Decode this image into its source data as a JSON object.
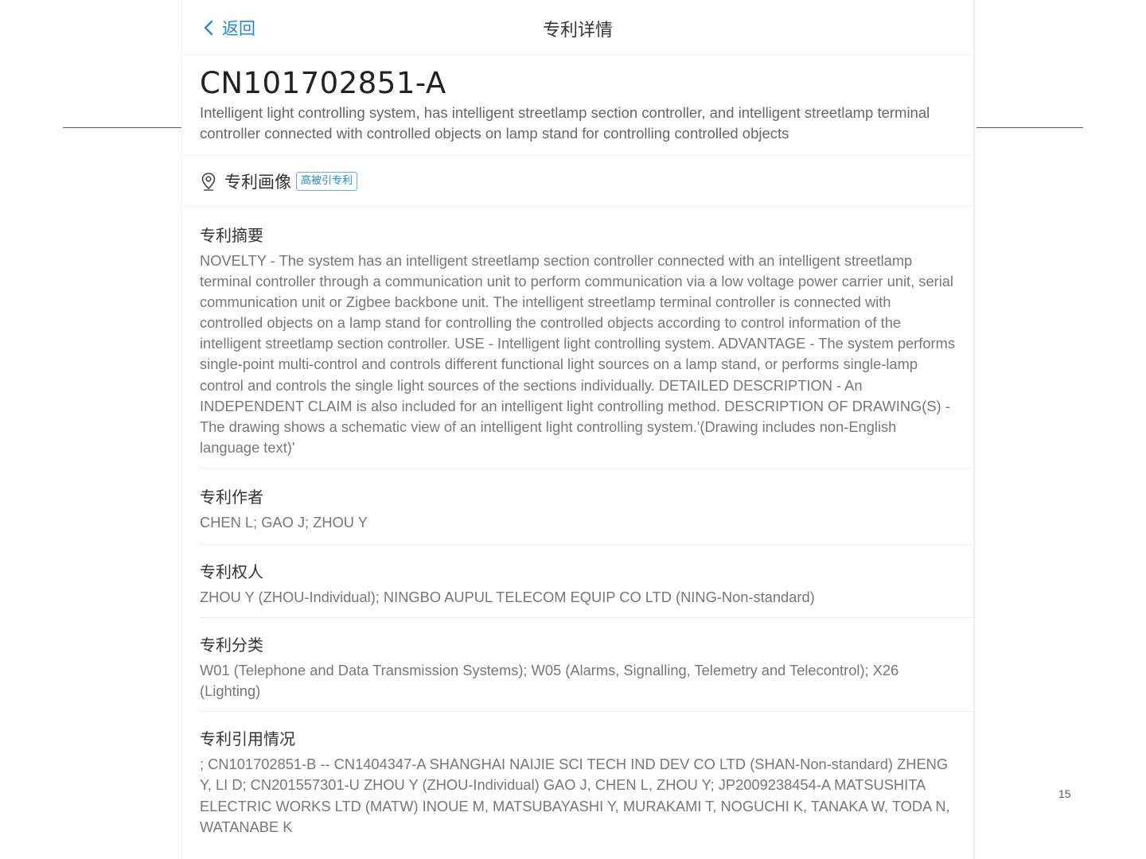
{
  "nav": {
    "back_label": "返回",
    "title": "专利详情"
  },
  "patent": {
    "id": "CN101702851-A",
    "title": "Intelligent light controlling system, has intelligent streetlamp section controller, and intelligent streetlamp terminal controller connected with controlled objects on lamp stand for controlling controlled objects"
  },
  "portrait": {
    "label": "专利画像",
    "badge": "高被引专利",
    "icon": "map-pin-icon"
  },
  "sections": {
    "abstract": {
      "title": "专利摘要",
      "body": "NOVELTY - The system has an intelligent streetlamp section controller connected with an intelligent streetlamp terminal controller through a communication unit to perform communication via a low voltage power carrier unit, serial communication unit or Zigbee backbone unit. The intelligent streetlamp terminal controller is connected with controlled objects on a lamp stand for controlling the controlled objects according to control information of the intelligent streetlamp section controller. USE - Intelligent light controlling system. ADVANTAGE - The system performs single-point multi-control and controls different functional light sources on a lamp stand, or performs single-lamp control and controls the single light sources of the sections individually. DETAILED DESCRIPTION - An INDEPENDENT CLAIM is also included for an intelligent light controlling method. DESCRIPTION OF DRAWING(S) - The drawing shows a schematic view of an intelligent light controlling system.'(Drawing includes non-English language text)'"
    },
    "authors": {
      "title": "专利作者",
      "body": "CHEN L; GAO J; ZHOU Y"
    },
    "owners": {
      "title": "专利权人",
      "body": "ZHOU Y (ZHOU-Individual); NINGBO AUPUL TELECOM EQUIP CO LTD (NING-Non-standard)"
    },
    "classification": {
      "title": "专利分类",
      "body": "W01 (Telephone and Data Transmission Systems); W05 (Alarms, Signalling, Telemetry and Telecontrol); X26 (Lighting)"
    },
    "citations": {
      "title": "专利引用情况",
      "body": "; CN101702851-B -- CN1404347-A SHANGHAI NAIJIE SCI TECH IND DEV CO LTD (SHAN-Non-standard) ZHENG Y, LI D; CN201557301-U ZHOU Y (ZHOU-Individual) GAO J, CHEN L, ZHOU Y; JP2009238454-A MATSUSHITA ELECTRIC WORKS LTD (MATW) INOUE M, MATSUBAYASHI Y, MURAKAMI T, NOGUCHI K, TANAKA W, TODA N, WATANABE K"
    }
  },
  "slide": {
    "page_number": "15"
  },
  "colors": {
    "accent": "#1e88e5",
    "title_text": "#333333",
    "body_text": "#777777",
    "divider": "#ececec"
  }
}
